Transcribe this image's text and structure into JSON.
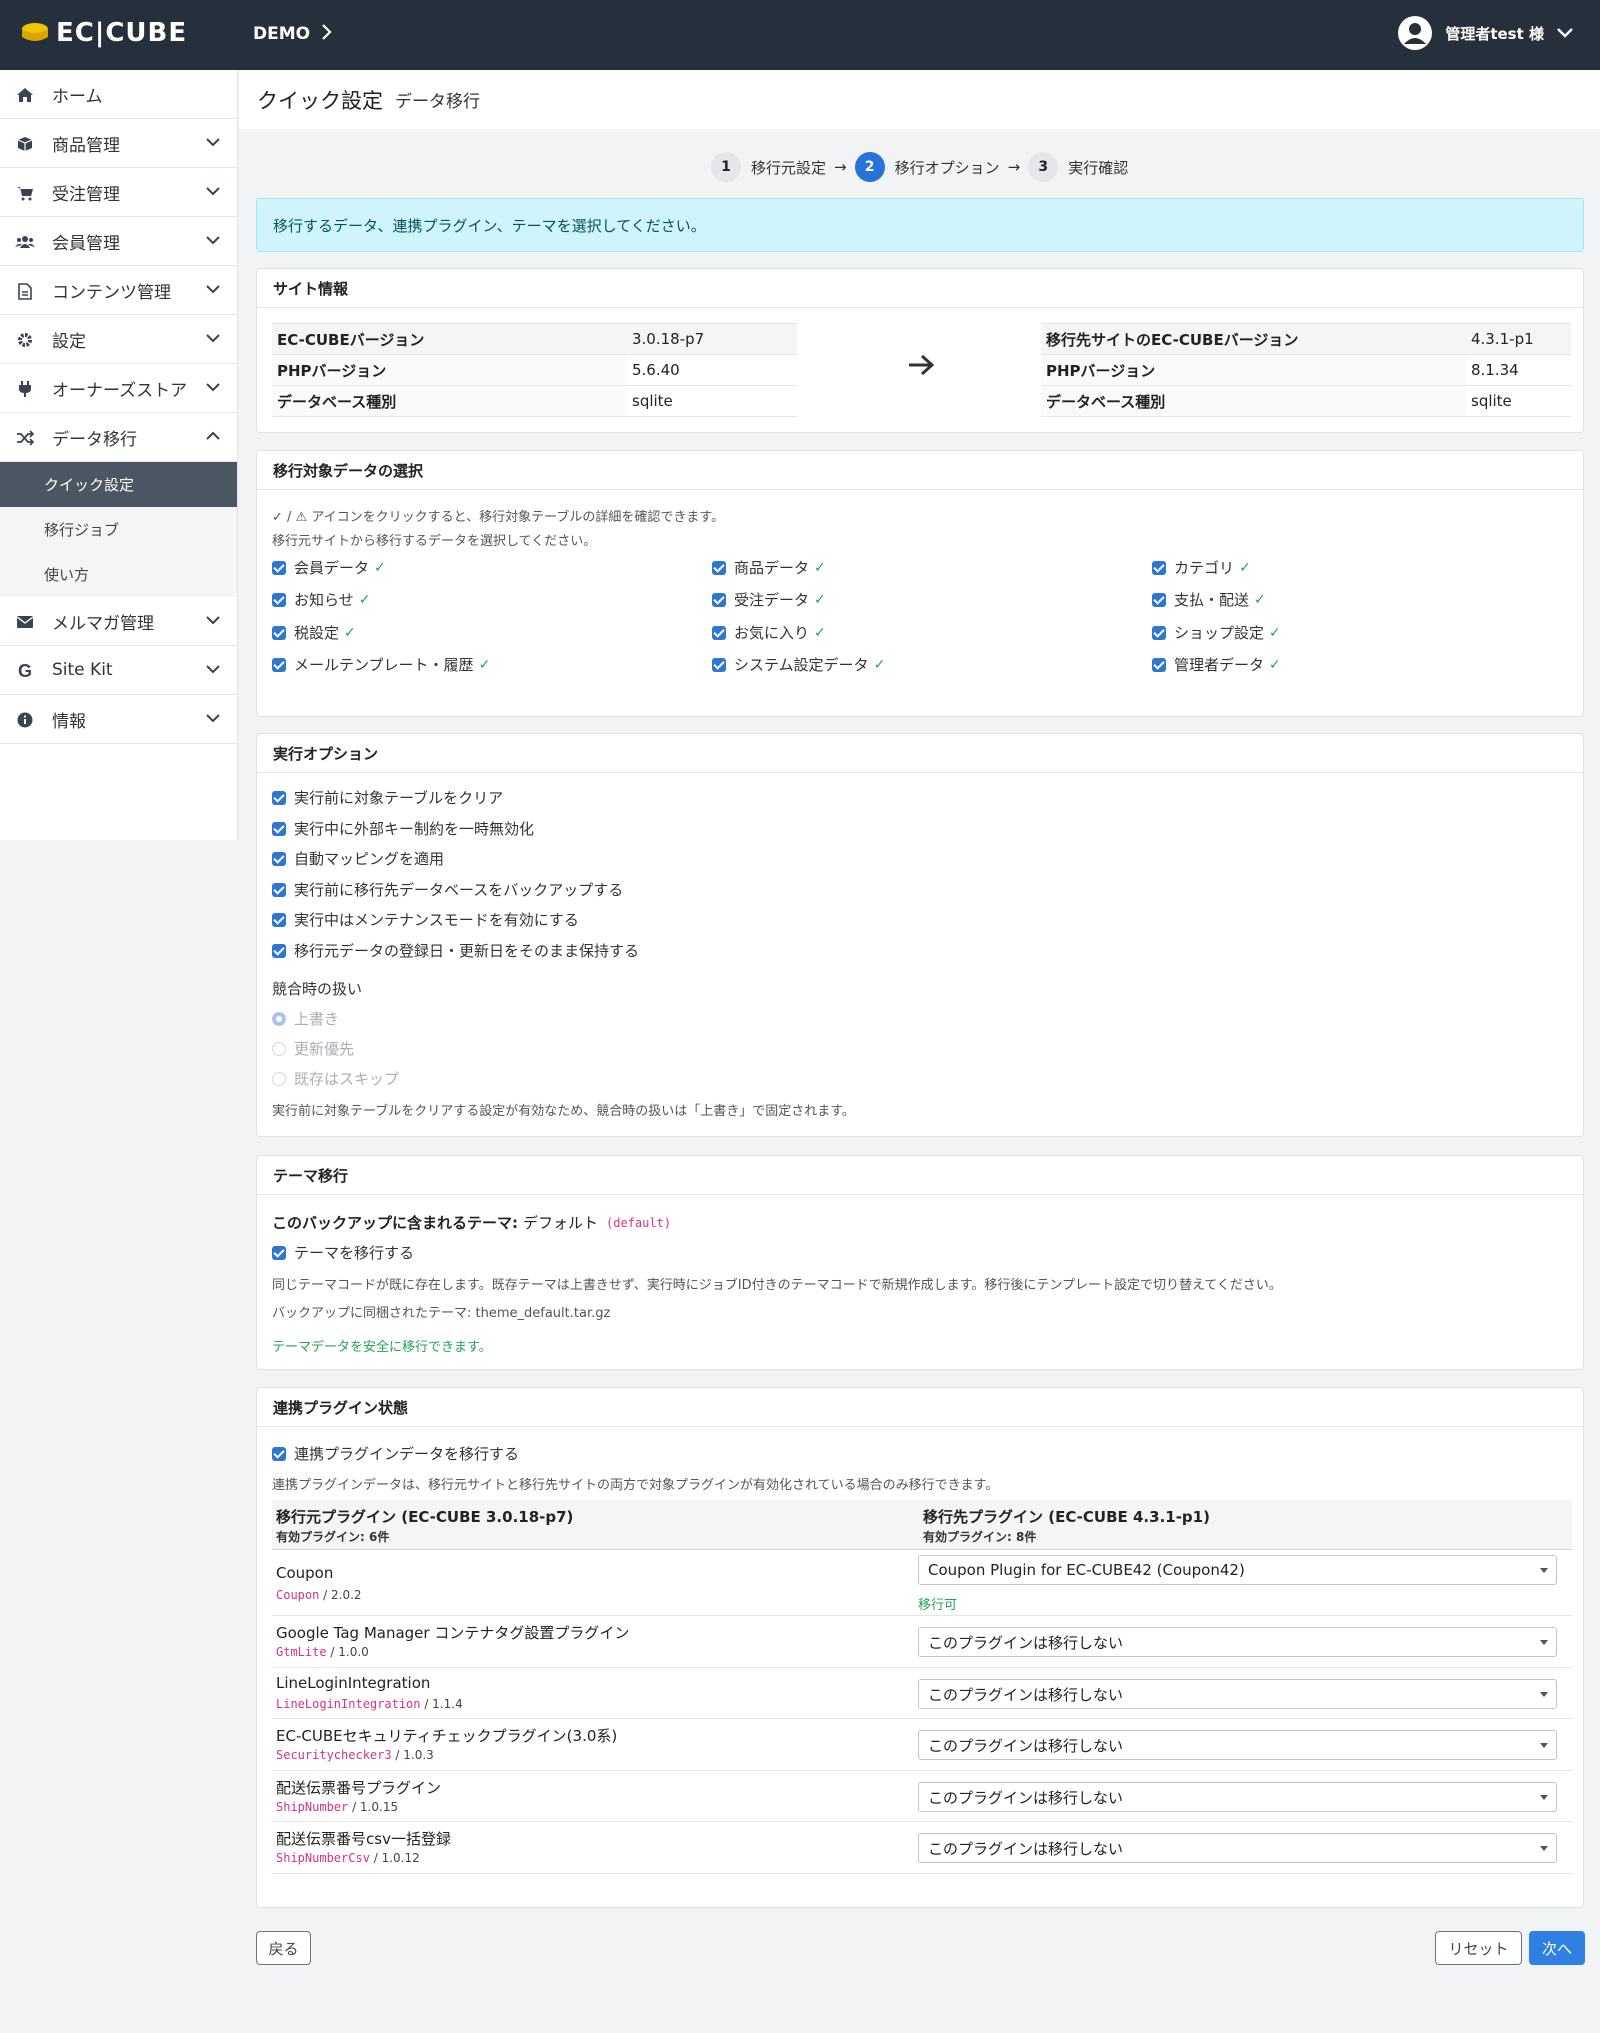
{
  "header": {
    "brand": "EC|CUBE",
    "shop_name": "DEMO",
    "user_name": "管理者test 様"
  },
  "sidebar": {
    "items": [
      {
        "label": "ホーム",
        "icon": "home-icon"
      },
      {
        "label": "商品管理",
        "icon": "box-icon"
      },
      {
        "label": "受注管理",
        "icon": "cart-icon"
      },
      {
        "label": "会員管理",
        "icon": "users-icon"
      },
      {
        "label": "コンテンツ管理",
        "icon": "file-icon"
      },
      {
        "label": "設定",
        "icon": "gear-icon"
      },
      {
        "label": "オーナーズストア",
        "icon": "plug-icon"
      },
      {
        "label": "データ移行",
        "icon": "shuffle-icon"
      }
    ],
    "sub_items": [
      "クイック設定",
      "移行ジョブ",
      "使い方"
    ],
    "items_after": [
      {
        "label": "メルマガ管理",
        "icon": "mail-icon"
      },
      {
        "label": "Site Kit",
        "icon": "google-icon"
      },
      {
        "label": "情報",
        "icon": "info-icon"
      }
    ]
  },
  "page": {
    "title": "クイック設定",
    "subtitle": "データ移行"
  },
  "steps": [
    {
      "num": "1",
      "label": "移行元設定"
    },
    {
      "num": "2",
      "label": "移行オプション"
    },
    {
      "num": "3",
      "label": "実行確認"
    }
  ],
  "alert": "移行するデータ、連携プラグイン、テーマを選択してください。",
  "site_info": {
    "title": "サイト情報",
    "source": [
      {
        "k": "EC-CUBEバージョン",
        "v": "3.0.18-p7"
      },
      {
        "k": "PHPバージョン",
        "v": "5.6.40"
      },
      {
        "k": "データベース種別",
        "v": "sqlite"
      }
    ],
    "target": [
      {
        "k": "移行先サイトのEC-CUBEバージョン",
        "v": "4.3.1-p1"
      },
      {
        "k": "PHPバージョン",
        "v": "8.1.34"
      },
      {
        "k": "データベース種別",
        "v": "sqlite"
      }
    ]
  },
  "targets": {
    "title": "移行対象データの選択",
    "note1": "✓ / ⚠ アイコンをクリックすると、移行対象テーブルの詳細を確認できます。",
    "note2": "移行元サイトから移行するデータを選択してください。",
    "check_mark": "✓",
    "items": [
      "会員データ",
      "商品データ",
      "カテゴリ",
      "お知らせ",
      "受注データ",
      "支払・配送",
      "税設定",
      "お気に入り",
      "ショップ設定",
      "メールテンプレート・履歴",
      "システム設定データ",
      "管理者データ"
    ]
  },
  "exec_options": {
    "title": "実行オプション",
    "options": [
      "実行前に対象テーブルをクリア",
      "実行中に外部キー制約を一時無効化",
      "自動マッピングを適用",
      "実行前に移行先データベースをバックアップする",
      "実行中はメンテナンスモードを有効にする",
      "移行元データの登録日・更新日をそのまま保持する"
    ],
    "conflict_label": "競合時の扱い",
    "conflict_choices": [
      "上書き",
      "更新優先",
      "既存はスキップ"
    ],
    "conflict_note": "実行前に対象テーブルをクリアする設定が有効なため、競合時の扱いは「上書き」で固定されます。"
  },
  "theme": {
    "title": "テーマ移行",
    "included_label": "このバックアップに含まれるテーマ:",
    "included_value": "デフォルト",
    "included_code": "(default)",
    "migrate_label": "テーマを移行する",
    "note": "同じテーマコードが既に存在します。既存テーマは上書きせず、実行時にジョブID付きのテーマコードで新規作成します。移行後にテンプレート設定で切り替えてください。",
    "bundled": "バックアップに同梱されたテーマ: theme_default.tar.gz",
    "ok_msg": "テーマデータを安全に移行できます。"
  },
  "plugins": {
    "title": "連携プラグイン状態",
    "migrate_label": "連携プラグインデータを移行する",
    "note": "連携プラグインデータは、移行元サイトと移行先サイトの両方で対象プラグインが有効化されている場合のみ移行できます。",
    "source_header": "移行元プラグイン (EC-CUBE 3.0.18-p7)",
    "source_count": "有効プラグイン: 6件",
    "target_header": "移行先プラグイン (EC-CUBE 4.3.1-p1)",
    "target_count": "有効プラグイン: 8件",
    "ok_label": "移行可",
    "rows": [
      {
        "name": "Coupon",
        "code": "Coupon",
        "version": " / 2.0.2",
        "select": "Coupon Plugin for EC-CUBE42 (Coupon42)"
      },
      {
        "name": "Google Tag Manager コンテナタグ設置プラグイン",
        "code": "GtmLite",
        "version": " / 1.0.0",
        "select": "このプラグインは移行しない"
      },
      {
        "name": "LineLoginIntegration",
        "code": "LineLoginIntegration",
        "version": " / 1.1.4",
        "select": "このプラグインは移行しない"
      },
      {
        "name": "EC-CUBEセキュリティチェックプラグイン(3.0系)",
        "code": "Securitychecker3",
        "version": " / 1.0.3",
        "select": "このプラグインは移行しない"
      },
      {
        "name": "配送伝票番号プラグイン",
        "code": "ShipNumber",
        "version": " / 1.0.15",
        "select": "このプラグインは移行しない"
      },
      {
        "name": "配送伝票番号csv一括登録",
        "code": "ShipNumberCsv",
        "version": " / 1.0.12",
        "select": "このプラグインは移行しない"
      }
    ]
  },
  "footer": {
    "back": "戻る",
    "reset": "リセット",
    "next": "次へ"
  }
}
